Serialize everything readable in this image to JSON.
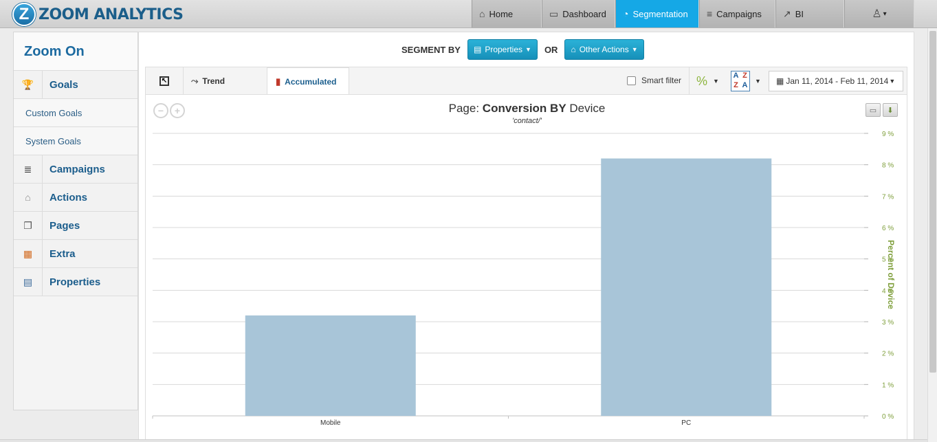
{
  "app": {
    "logo_letter": "Z",
    "logo_text": "ZOOM ANALYTICS"
  },
  "nav": {
    "items": [
      {
        "label": "Home",
        "icon": "home-icon",
        "glyph": "⌂",
        "active": false
      },
      {
        "label": "Dashboard",
        "icon": "monitor-icon",
        "glyph": "▭",
        "active": false
      },
      {
        "label": "Segmentation",
        "icon": "pie-chart-icon",
        "glyph": "◔",
        "active": true
      },
      {
        "label": "Campaigns",
        "icon": "coins-icon",
        "glyph": "≡",
        "active": false
      },
      {
        "label": "BI",
        "icon": "line-chart-icon",
        "glyph": "↗",
        "active": false
      }
    ],
    "user_glyph": "♙",
    "user_caret": "▾"
  },
  "sidebar": {
    "title": "Zoom On",
    "goals": {
      "label": "Goals",
      "icon": "trophy-icon",
      "glyph": "🏆"
    },
    "sub_items": [
      {
        "label": "Custom Goals"
      },
      {
        "label": "System Goals"
      }
    ],
    "items": [
      {
        "label": "Campaigns",
        "icon": "coins-icon",
        "glyph": "≣"
      },
      {
        "label": "Actions",
        "icon": "mouse-icon",
        "glyph": "⌂"
      },
      {
        "label": "Pages",
        "icon": "pages-icon",
        "glyph": "❐"
      },
      {
        "label": "Extra",
        "icon": "grid-icon",
        "glyph": "▦"
      },
      {
        "label": "Properties",
        "icon": "id-card-icon",
        "glyph": "▤"
      }
    ]
  },
  "segment": {
    "label": "SEGMENT BY",
    "properties_label": "Properties",
    "or_label": "OR",
    "other_actions_label": "Other Actions"
  },
  "toolbar": {
    "trend_label": "Trend",
    "accumulated_label": "Accumulated",
    "smart_filter_label": "Smart filter",
    "percent_symbol": "%",
    "sort_letters": [
      "A",
      "Z",
      "Z",
      "A"
    ],
    "date_range": "Jan 11, 2014 - Feb 11, 2014"
  },
  "colors": {
    "accent": "#15a8e6",
    "bar": "#a8c5d8",
    "axis_label": "#7f9f3c"
  },
  "chart_data": {
    "type": "bar",
    "title_prefix": "Page:",
    "title_main": "Conversion BY",
    "title_suffix": "Device",
    "subtitle": "'contact/'",
    "categories": [
      "Mobile",
      "PC"
    ],
    "values": [
      3.2,
      8.2
    ],
    "ylabel": "Percent of Device",
    "ylim": [
      0,
      9
    ],
    "yticks": [
      "0 %",
      "1 %",
      "2 %",
      "3 %",
      "4 %",
      "5 %",
      "6 %",
      "7 %",
      "8 %",
      "9 %"
    ],
    "y_axis_position": "right",
    "grid": true,
    "legend": false
  }
}
